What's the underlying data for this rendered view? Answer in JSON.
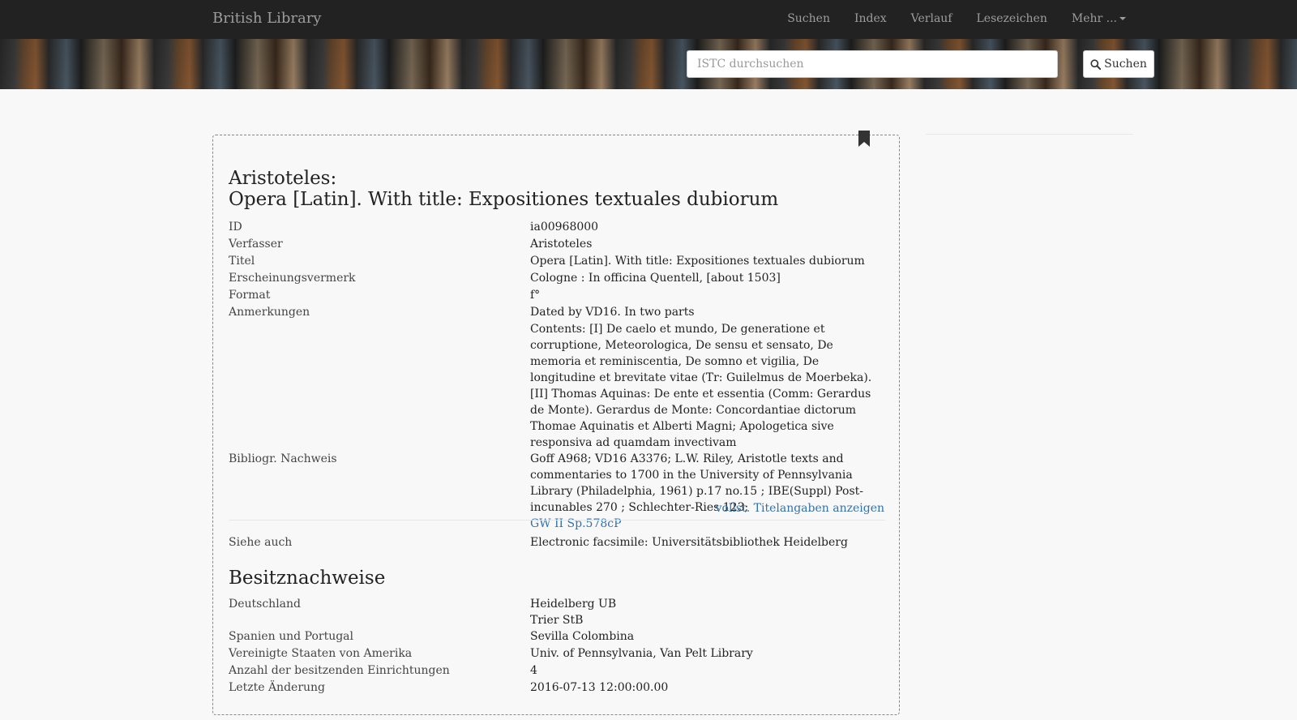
{
  "navbar": {
    "brand": "British Library",
    "items": [
      "Suchen",
      "Index",
      "Verlauf",
      "Lesezeichen",
      "Mehr ..."
    ]
  },
  "search": {
    "placeholder": "ISTC durchsuchen",
    "button_label": "Suchen"
  },
  "record": {
    "title_author": "Aristoteles:",
    "title_main": "Opera [Latin]. With title: Expositiones textuales dubiorum",
    "fields": {
      "id": {
        "label": "ID",
        "value": "ia00968000"
      },
      "author": {
        "label": "Verfasser",
        "value": "Aristoteles"
      },
      "title": {
        "label": "Titel",
        "value": "Opera [Latin]. With title: Expositiones textuales dubiorum"
      },
      "imprint": {
        "label": "Erscheinungsvermerk",
        "value": "Cologne : In officina Quentell, [about 1503]"
      },
      "format": {
        "label": "Format",
        "value": "f°"
      },
      "notes": {
        "label": "Anmerkungen",
        "value": "Dated by VD16. In two parts"
      },
      "contents": {
        "value": "Contents: [I] De caelo et mundo, De generatione et corruptione, Meteorologica, De sensu et sensato, De memoria et reminiscentia, De somno et vigilia, De longitudine et brevitate vitae (Tr: Guilelmus de Moerbeka). [II] Thomas Aquinas: De ente et essentia (Comm: Gerardus de Monte). Gerardus de Monte: Concordantiae dictorum Thomae Aquinatis et Alberti Magni; Apologetica sive responsiva ad quamdam invectivam"
      },
      "bibliography": {
        "label": "Bibliogr. Nachweis",
        "value": "Goff A968; VD16 A3376; L.W. Riley, Aristotle texts and commentaries to 1700 in the University of Pennsylvania Library (Philadelphia, 1961) p.17 no.15 ; IBE(Suppl) Post-incunables 270 ; Schlechter-Ries 123;",
        "link": "GW II Sp.578cP"
      }
    },
    "more_link": "vollst. Titelangaben anzeigen",
    "see_also": {
      "label": "Siehe auch",
      "value": "Electronic facsimile: Universitätsbibliothek Heidelberg"
    },
    "holdings_title": "Besitznachweise",
    "holdings": {
      "germany": {
        "label": "Deutschland",
        "values": [
          "Heidelberg UB",
          "Trier StB"
        ]
      },
      "spain": {
        "label": "Spanien und Portugal",
        "value": "Sevilla Colombina"
      },
      "usa": {
        "label": "Vereinigte Staaten von Amerika",
        "value": "Univ. of Pennsylvania, Van Pelt Library"
      },
      "count": {
        "label": "Anzahl der besitzenden Einrichtungen",
        "value": "4"
      },
      "modified": {
        "label": "Letzte Änderung",
        "value": "2016-07-13 12:00:00.00"
      }
    }
  }
}
